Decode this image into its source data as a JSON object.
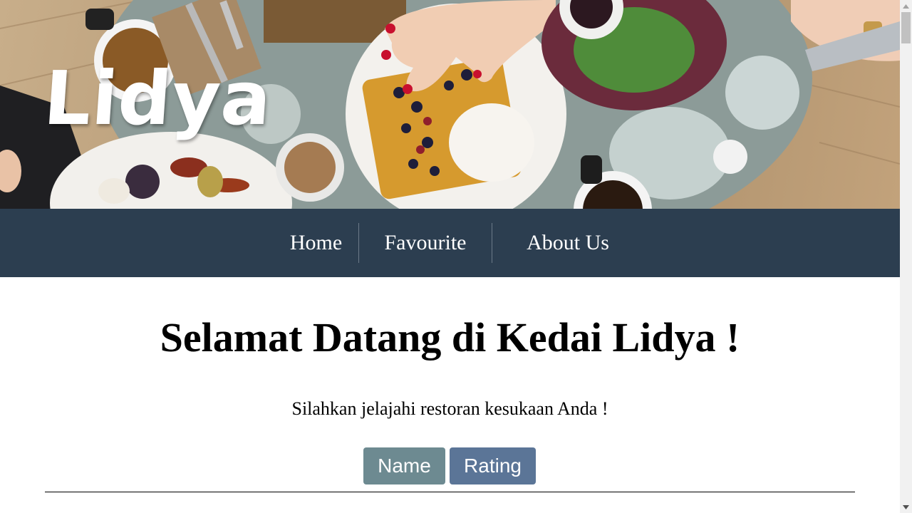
{
  "hero": {
    "brand": "Lidya",
    "image_icon": "food-table-photo"
  },
  "nav": {
    "items": [
      {
        "label": "Home"
      },
      {
        "label": "Favourite"
      },
      {
        "label": "About Us"
      }
    ]
  },
  "main": {
    "headline": "Selamat Datang di Kedai Lidya !",
    "subtitle": "Silahkan jelajahi restoran kesukaan Anda !",
    "sort_buttons": {
      "name_label": "Name",
      "rating_label": "Rating"
    }
  },
  "colors": {
    "navbar": "#2c3e50",
    "name_button": "#6d8a91",
    "rating_button": "#5b7597",
    "nav_text": "#ffffff"
  },
  "scrollbar": {
    "up_icon": "scroll-up-arrow-icon",
    "down_icon": "scroll-down-arrow-icon"
  }
}
